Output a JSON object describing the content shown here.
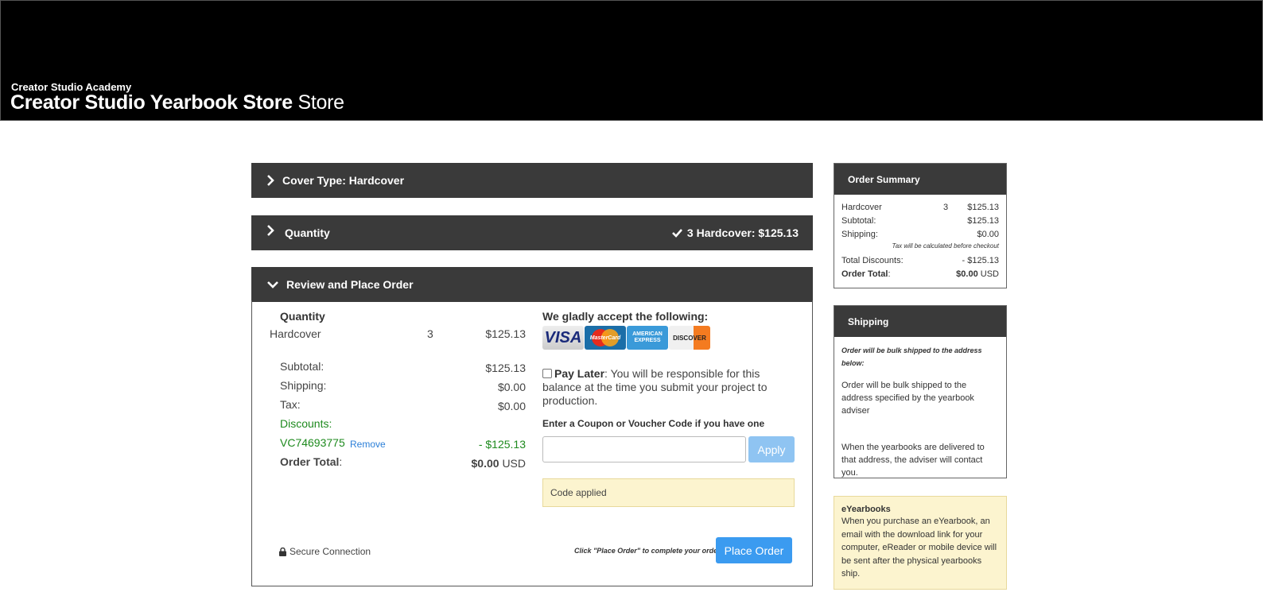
{
  "header": {
    "school": "Creator Studio Academy",
    "store_name": "Creator Studio Yearbook Store",
    "store_suffix": "Store"
  },
  "sections": {
    "cover": {
      "label": "Cover Type: Hardcover"
    },
    "quantity": {
      "label": "Quantity",
      "summary": "3 Hardcover: $125.13"
    },
    "review": {
      "label": "Review and Place Order"
    }
  },
  "review": {
    "qty_heading": "Quantity",
    "item": {
      "name": "Hardcover",
      "qty": "3",
      "price": "$125.13"
    },
    "subtotal_label": "Subtotal:",
    "subtotal": "$125.13",
    "shipping_label": "Shipping:",
    "shipping": "$0.00",
    "tax_label": "Tax:",
    "tax": "$0.00",
    "discounts_label": "Discounts:",
    "voucher_code": "VC74693775",
    "remove_label": "Remove",
    "voucher_amount": "- $125.13",
    "total_label": "Order Total",
    "total_colon": ":",
    "total": "$0.00",
    "currency": "USD",
    "accept_heading": "We gladly accept the following:",
    "cards": [
      "VISA",
      "MasterCard",
      "AMERICAN EXPRESS",
      "DISCOVER"
    ],
    "pay_later_bold": "Pay Later",
    "pay_later_text": ": You will be responsible for this balance at the time you submit your project to production.",
    "coupon_label": "Enter a Coupon or Voucher Code if you have one",
    "coupon_value": "",
    "apply_label": "Apply",
    "notice": "Code applied",
    "secure_label": "Secure Connection",
    "place_hint": "Click \"Place Order\" to complete your order.",
    "place_label": "Place Order"
  },
  "order_summary": {
    "title": "Order Summary",
    "item": {
      "name": "Hardcover",
      "qty": "3",
      "price": "$125.13"
    },
    "subtotal_label": "Subtotal:",
    "subtotal": "$125.13",
    "shipping_label": "Shipping:",
    "shipping": "$0.00",
    "tax_note": "Tax will be calculated before checkout",
    "discounts_label": "Total Discounts:",
    "discounts": "- $125.13",
    "total_label": "Order Total",
    "total_colon": ":",
    "total": "$0.00",
    "currency": "USD"
  },
  "shipping": {
    "title": "Shipping",
    "note": "Order will be bulk shipped to the address below:",
    "para1": "Order will be bulk shipped to the address specified by the yearbook adviser",
    "para2": "When the yearbooks are delivered to that address, the adviser will contact you."
  },
  "eyearbooks": {
    "title": "eYearbooks",
    "text": "When you purchase an eYearbook, an email with the download link for your computer, eReader or mobile device will be sent after the physical yearbooks ship."
  },
  "colors": {
    "accent": "#3b9bf0",
    "discount": "#1e8a1e",
    "bar": "#3a3a3a",
    "notice_bg": "#fcf4cf"
  }
}
